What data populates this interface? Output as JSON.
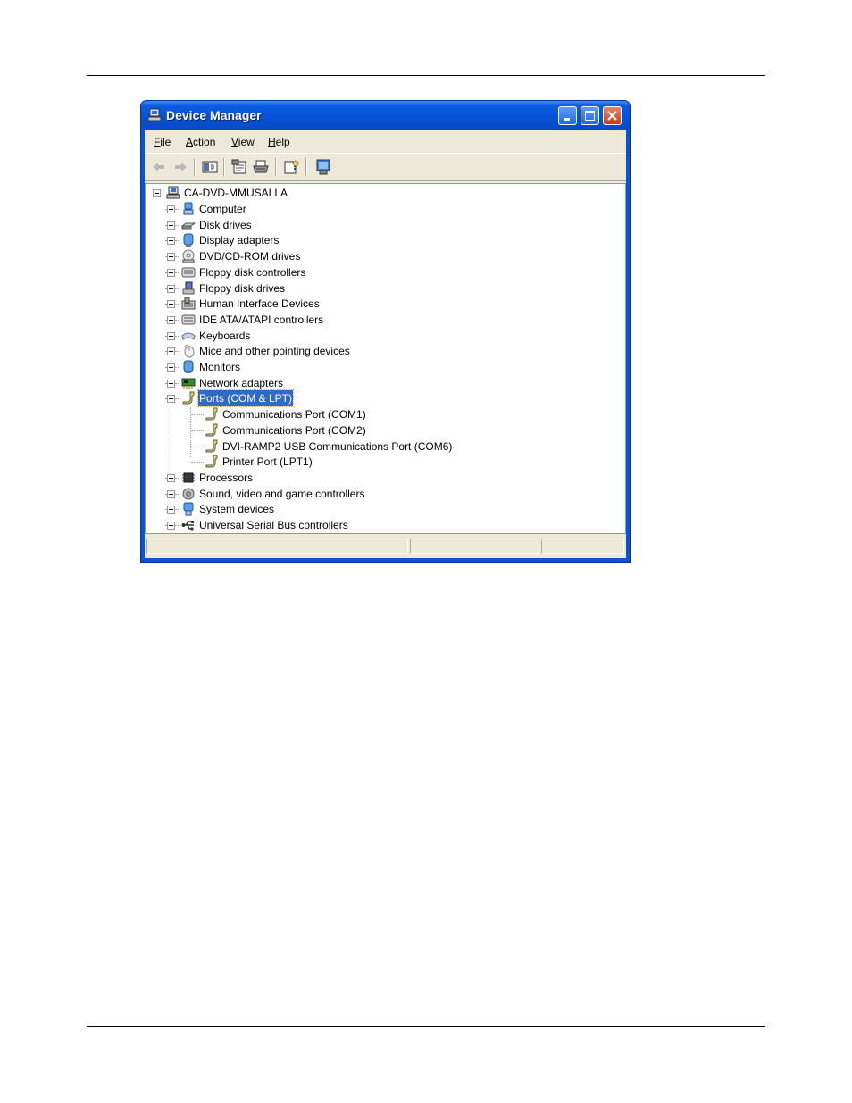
{
  "window": {
    "title": "Device Manager",
    "title_icon": "device-manager-icon",
    "caption_buttons": [
      "minimize",
      "maximize",
      "close"
    ]
  },
  "menu": {
    "items": [
      {
        "label": "File",
        "accel": "F",
        "rest": "ile"
      },
      {
        "label": "Action",
        "accel": "A",
        "rest": "ction"
      },
      {
        "label": "View",
        "accel": "V",
        "rest": "iew"
      },
      {
        "label": "Help",
        "accel": "H",
        "rest": "elp"
      }
    ]
  },
  "toolbar": {
    "buttons": [
      "back-arrow-icon",
      "forward-arrow-icon",
      "show-hide-tree-icon",
      "properties-icon",
      "print-icon",
      "help-icon",
      "scan-hardware-icon"
    ]
  },
  "tree": {
    "root": "CA-DVD-MMUSALLA",
    "categories": [
      {
        "label": "Computer",
        "icon": "computer-icon"
      },
      {
        "label": "Disk drives",
        "icon": "disk-drive-icon"
      },
      {
        "label": "Display adapters",
        "icon": "display-adapter-icon"
      },
      {
        "label": "DVD/CD-ROM drives",
        "icon": "dvd-drive-icon"
      },
      {
        "label": "Floppy disk controllers",
        "icon": "floppy-controller-icon"
      },
      {
        "label": "Floppy disk drives",
        "icon": "floppy-drive-icon"
      },
      {
        "label": "Human Interface Devices",
        "icon": "hid-icon"
      },
      {
        "label": "IDE ATA/ATAPI controllers",
        "icon": "ide-controller-icon"
      },
      {
        "label": "Keyboards",
        "icon": "keyboard-icon"
      },
      {
        "label": "Mice and other pointing devices",
        "icon": "mouse-icon"
      },
      {
        "label": "Monitors",
        "icon": "monitor-icon"
      },
      {
        "label": "Network adapters",
        "icon": "network-adapter-icon"
      },
      {
        "label": "Ports (COM & LPT)",
        "icon": "port-icon",
        "expanded": true,
        "selected": true
      },
      {
        "label": "Processors",
        "icon": "processor-icon"
      },
      {
        "label": "Sound, video and game controllers",
        "icon": "sound-icon"
      },
      {
        "label": "System devices",
        "icon": "system-device-icon"
      },
      {
        "label": "Universal Serial Bus controllers",
        "icon": "usb-icon"
      }
    ],
    "ports_children": [
      {
        "label": "Communications Port (COM1)",
        "icon": "port-icon"
      },
      {
        "label": "Communications Port (COM2)",
        "icon": "port-icon"
      },
      {
        "label": "DVI-RAMP2 USB Communications Port (COM6)",
        "icon": "port-icon"
      },
      {
        "label": "Printer Port (LPT1)",
        "icon": "port-icon"
      }
    ]
  },
  "colors": {
    "titlebar": "#0A53D9",
    "selection": "#316AC5",
    "client": "#ECE9D8"
  }
}
